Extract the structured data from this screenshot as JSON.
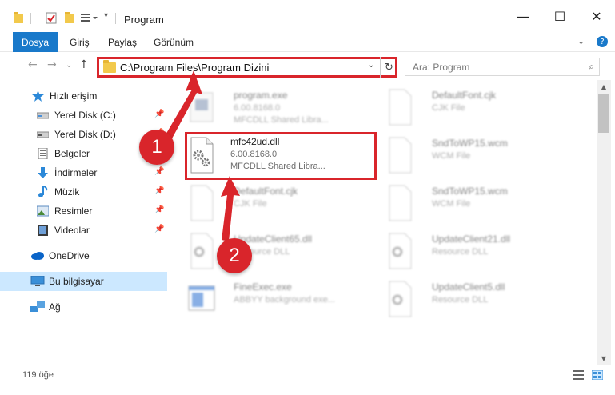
{
  "window": {
    "title": "Program",
    "minimize_glyph": "—",
    "maximize_glyph": "☐",
    "close_glyph": "✕"
  },
  "ribbon": {
    "tabs": [
      "Dosya",
      "Giriş",
      "Paylaş",
      "Görünüm"
    ],
    "expand_glyph": "⌄",
    "help_glyph": "?"
  },
  "nav": {
    "back_glyph": "←",
    "forward_glyph": "→",
    "recent_glyph": "⌄",
    "up_glyph": "↑"
  },
  "address": {
    "path": "C:\\Program Files\\Program Dizini",
    "dropdown_glyph": "⌄",
    "refresh_glyph": "↻"
  },
  "search": {
    "placeholder": "Ara: Program",
    "icon_glyph": "⌕"
  },
  "sidebar": {
    "items": [
      {
        "label": "Hızlı erişim",
        "icon": "star-icon",
        "pinned": false
      },
      {
        "label": "Yerel Disk (C:)",
        "icon": "drive-icon",
        "pinned": true
      },
      {
        "label": "Yerel Disk (D:)",
        "icon": "drive-icon",
        "pinned": true
      },
      {
        "label": "Belgeler",
        "icon": "documents-icon",
        "pinned": true
      },
      {
        "label": "İndirmeler",
        "icon": "download-icon",
        "pinned": true
      },
      {
        "label": "Müzik",
        "icon": "music-icon",
        "pinned": true
      },
      {
        "label": "Resimler",
        "icon": "pictures-icon",
        "pinned": true
      },
      {
        "label": "Videolar",
        "icon": "videos-icon",
        "pinned": true
      },
      {
        "label": "OneDrive",
        "icon": "cloud-icon",
        "pinned": false
      },
      {
        "label": "Bu bilgisayar",
        "icon": "computer-icon",
        "pinned": false,
        "selected": true
      },
      {
        "label": "Ağ",
        "icon": "network-icon",
        "pinned": false
      }
    ],
    "pin_glyph": "📌"
  },
  "files": {
    "left": [
      {
        "name": "program.exe",
        "line1": "6.00.8168.0",
        "line2": "MFCDLL Shared Libra...",
        "icon": "exe-icon"
      },
      {
        "name": "mfc42ud.dll",
        "line1": "6.00.8168.0",
        "line2": "MFCDLL Shared Libra...",
        "icon": "dll-gear-icon",
        "highlighted": true
      },
      {
        "name": "DefaultFont.cjk",
        "line1": "CJK File",
        "line2": "",
        "icon": "blank-file-icon"
      },
      {
        "name": "UpdateClient65.dll",
        "line1": "Resource DLL",
        "line2": "",
        "icon": "dll-gear-icon"
      },
      {
        "name": "FineExec.exe",
        "line1": "ABBYY background exe...",
        "line2": "",
        "icon": "exe-window-icon"
      }
    ],
    "right": [
      {
        "name": "DefaultFont.cjk",
        "line1": "CJK File",
        "line2": "",
        "icon": "blank-file-icon"
      },
      {
        "name": "SndToWP15.wcm",
        "line1": "WCM File",
        "line2": "",
        "icon": "blank-file-icon"
      },
      {
        "name": "SndToWP15.wcm",
        "line1": "WCM File",
        "line2": "",
        "icon": "blank-file-icon"
      },
      {
        "name": "UpdateClient21.dll",
        "line1": "Resource DLL",
        "line2": "",
        "icon": "dll-gear-icon"
      },
      {
        "name": "UpdateClient5.dll",
        "line1": "Resource DLL",
        "line2": "",
        "icon": "dll-gear-icon"
      }
    ]
  },
  "callouts": [
    "1",
    "2"
  ],
  "status": {
    "count": "119 öğe"
  },
  "colors": {
    "accent": "#1979ca",
    "highlight_red": "#d9252b",
    "selected_bg": "#cce8ff"
  }
}
